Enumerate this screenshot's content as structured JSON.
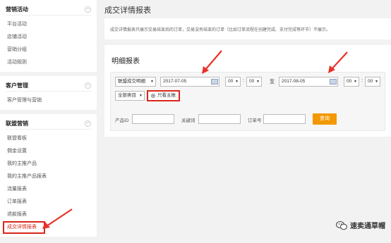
{
  "sidebar": {
    "groups": [
      {
        "title": "营销活动",
        "toggle": "⊖",
        "items": [
          "平台活动",
          "店铺活动",
          "营销分组",
          "活动规则"
        ]
      },
      {
        "title": "客户管理",
        "toggle": "⊖",
        "items": [
          "客户管理与营销"
        ]
      },
      {
        "title": "联盟营销",
        "toggle": "⊖",
        "items": [
          "联盟看板",
          "佣金设置",
          "我的主推产品",
          "我的主推产品报表",
          "流量报表",
          "订单报表",
          "退款报表",
          "成交详情报表"
        ]
      }
    ],
    "active_item": "成交详情报表"
  },
  "main": {
    "title": "成交详情报表",
    "note": "成交详情报表只展示交易结束后的订单，交易没有结束的订单（比如订单流程在创建完成、支付完成等环节）不展示。",
    "panel_title": "明细报表",
    "filters": {
      "type_select": "联盟成交明细",
      "start_date": "2017-07-05",
      "start_hour": "00",
      "start_min": "00",
      "to_label": "至",
      "end_date": "2017-08-05",
      "end_hour": "00",
      "end_min": "00",
      "category_select": "全部类目",
      "radio_label": "只看主推",
      "product_id_label": "产品ID",
      "keyword_label": "关键词",
      "order_no_label": "订单号",
      "query_button": "查询"
    }
  },
  "watermark": {
    "text": "速卖通草帽"
  },
  "colors": {
    "highlight_red": "#d9261c",
    "arrow_red": "#e8322a",
    "query_orange": "#f39800"
  }
}
